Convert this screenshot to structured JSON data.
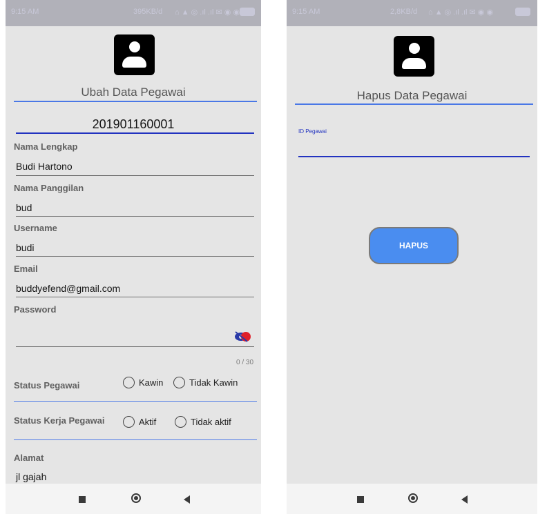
{
  "left_screen": {
    "statusbar": {
      "time": "9:15 AM",
      "network": "395KB/d"
    },
    "title": "Ubah Data Pegawai",
    "employee_id": "201901160001",
    "fields": [
      {
        "label": "Nama Lengkap",
        "value": "Budi Hartono"
      },
      {
        "label": "Nama Panggilan",
        "value": "bud"
      },
      {
        "label": "Username",
        "value": "budi"
      },
      {
        "label": "Email",
        "value": "buddyefend@gmail.com"
      }
    ],
    "password": {
      "label": "Password",
      "value": "",
      "counter": "0 / 30"
    },
    "status_pegawai": {
      "label": "Status Pegawai",
      "options": [
        "Kawin",
        "Tidak Kawin"
      ]
    },
    "status_kerja": {
      "label": "Status Kerja Pegawai",
      "options": [
        "Aktif",
        "Tidak aktif"
      ]
    },
    "alamat": {
      "label": "Alamat",
      "value": "jl gajah"
    }
  },
  "right_screen": {
    "statusbar": {
      "time": "9:15 AM",
      "network": "2,8KB/d"
    },
    "title": "Hapus Data Pegawai",
    "id_label": "ID Pegawai",
    "id_value": "",
    "button_label": "HAPUS"
  },
  "colors": {
    "accent_blue": "#4a78e6",
    "dark_blue": "#2233c0",
    "button_blue": "#4a8df0",
    "screen_bg": "#e5e5e5",
    "statusbar_bg": "#b1b1b9"
  },
  "icons": {
    "avatar": "account-icon",
    "password_toggle": "visibility-off-icon",
    "nav": [
      "recent-apps-icon",
      "home-icon",
      "back-icon"
    ]
  }
}
